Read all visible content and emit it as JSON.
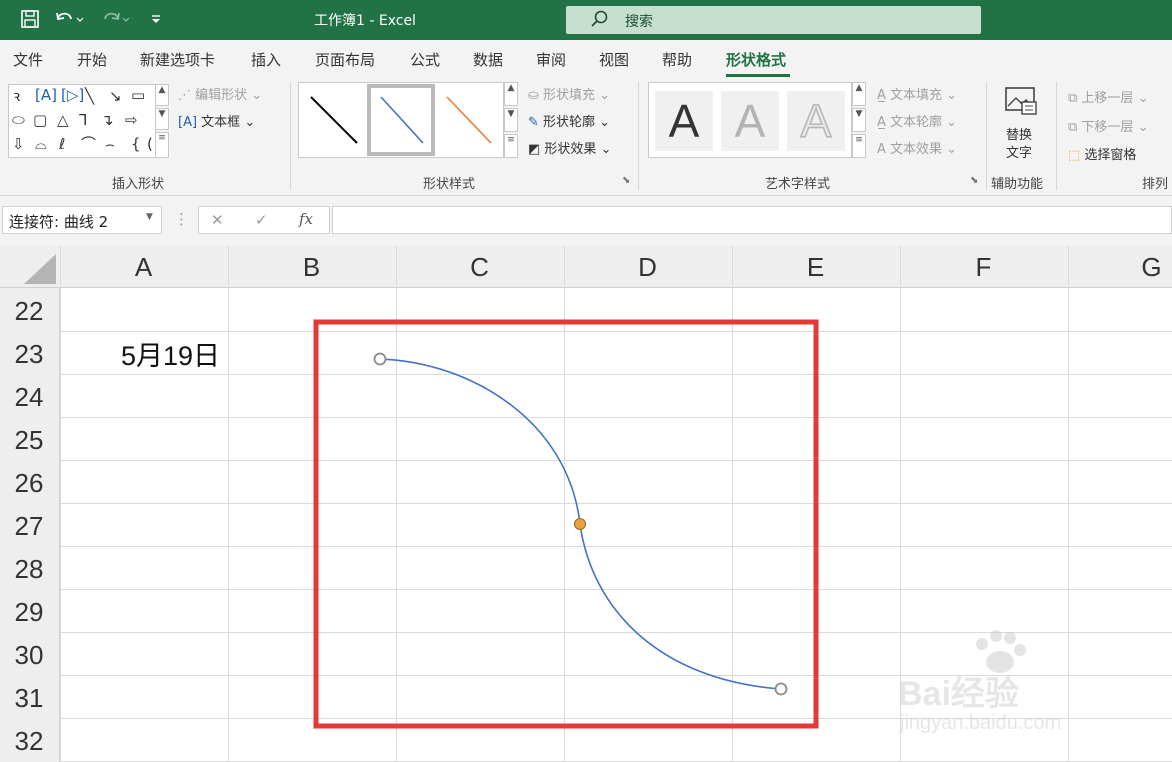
{
  "window": {
    "title": "工作簿1  -  Excel"
  },
  "quick_access": {
    "save_icon": "save-icon",
    "undo_icon": "undo-icon",
    "redo_icon": "redo-icon",
    "customize_icon": "customize-icon"
  },
  "search": {
    "label": "搜索"
  },
  "tabs": [
    {
      "label": "文件"
    },
    {
      "label": "开始"
    },
    {
      "label": "新建选项卡"
    },
    {
      "label": "插入"
    },
    {
      "label": "页面布局"
    },
    {
      "label": "公式"
    },
    {
      "label": "数据"
    },
    {
      "label": "审阅"
    },
    {
      "label": "视图"
    },
    {
      "label": "帮助"
    },
    {
      "label": "形状格式",
      "active": true
    }
  ],
  "ribbon": {
    "insert_shapes": {
      "label": "插入形状",
      "edit_shape": "编辑形状",
      "text_box": "文本框"
    },
    "shape_styles": {
      "label": "形状样式",
      "fill": "形状填充",
      "outline": "形状轮廓",
      "effects": "形状效果"
    },
    "wordart": {
      "label": "艺术字样式",
      "letter": "A",
      "text_fill": "文本填充",
      "text_outline": "文本轮廓",
      "text_effects": "文本效果"
    },
    "accessibility": {
      "label": "辅助功能",
      "alt_text_line1": "替换",
      "alt_text_line2": "文字"
    },
    "arrange": {
      "label": "排列",
      "bring_forward": "上移一层",
      "send_backward": "下移一层",
      "selection_pane": "选择窗格"
    }
  },
  "formula_bar": {
    "name_box": "连接符: 曲线 2",
    "fx": "fx",
    "formula": ""
  },
  "columns": [
    "A",
    "B",
    "C",
    "D",
    "E",
    "F",
    "G"
  ],
  "rows": [
    "22",
    "23",
    "24",
    "25",
    "26",
    "27",
    "28",
    "29",
    "30",
    "31",
    "32"
  ],
  "cells": {
    "A23": "5月19日"
  },
  "colors": {
    "accent": "#217346",
    "curve": "#4472c4",
    "highlight": "#e53935",
    "handle": "#e8a33d"
  },
  "watermark": {
    "brand": "Bai经验",
    "url": "jingyan.baidu.com"
  }
}
